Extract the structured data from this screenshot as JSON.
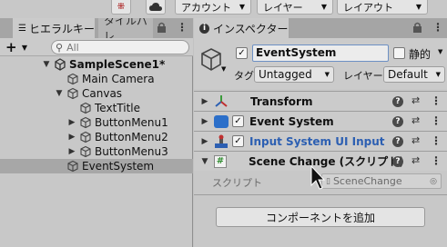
{
  "toolbar": {
    "account_label": "アカウント",
    "layers_label": "レイヤー",
    "layout_label": "レイアウト"
  },
  "hierarchy": {
    "tab_label": "ヒエラルキー",
    "second_tab_label": "タイルパレ",
    "add_label": "+",
    "search_placeholder": "All",
    "scene_name": "SampleScene1*",
    "items": [
      {
        "label": "Main Camera"
      },
      {
        "label": "Canvas"
      },
      {
        "label": "TextTitle"
      },
      {
        "label": "ButtonMenu1"
      },
      {
        "label": "ButtonMenu2"
      },
      {
        "label": "ButtonMenu3"
      },
      {
        "label": "EventSystem"
      }
    ]
  },
  "inspector": {
    "tab_label": "インスペクター",
    "object_name": "EventSystem",
    "static_label": "静的",
    "tag_label": "タグ",
    "tag_value": "Untagged",
    "layer_label": "レイヤー",
    "layer_value": "Default",
    "components": [
      {
        "title": "Transform"
      },
      {
        "title": "Event System"
      },
      {
        "title": "Input System UI Input I"
      },
      {
        "title": "Scene Change (スクリプト)"
      }
    ],
    "script_field_label": "スクリプト",
    "script_field_value": "SceneChange",
    "add_component_label": "コンポーネントを追加"
  },
  "colors": {
    "accent_blue": "#2c5fb2",
    "selected_row": "#a7a7a7",
    "panel_bg": "#c8c8c8"
  }
}
